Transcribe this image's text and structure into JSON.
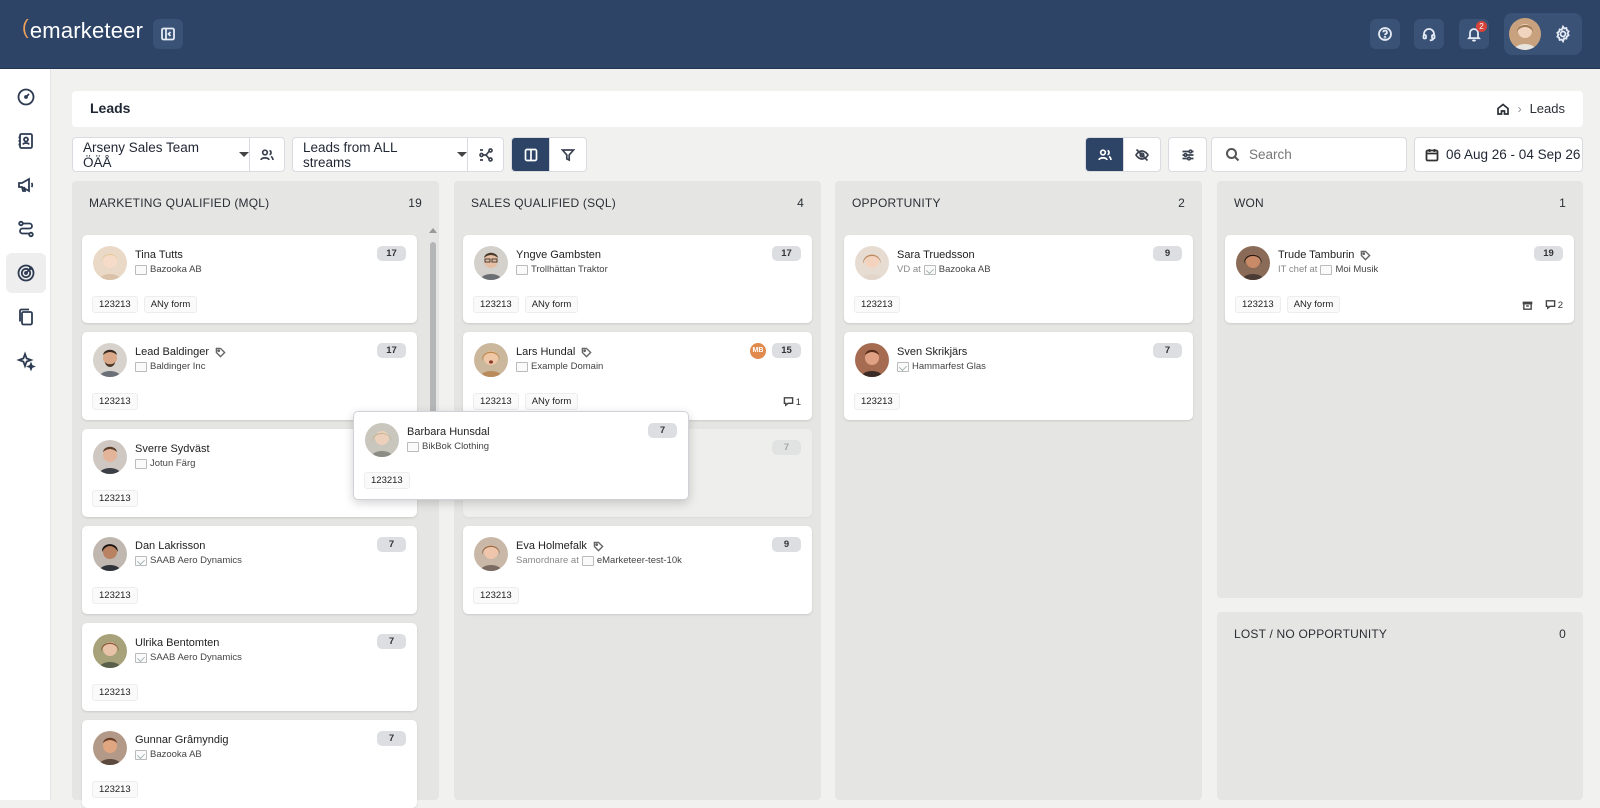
{
  "brand": {
    "logo_text": "emarketeer",
    "logo_mark": "("
  },
  "topbar": {
    "notification_count": "2"
  },
  "header": {
    "title": "Leads",
    "breadcrumb_current": "Leads"
  },
  "toolbar": {
    "team_select": "Arseny Sales Team ÖÄÅ",
    "stream_select": "Leads from ALL streams",
    "search_placeholder": "Search",
    "date_range": "06 Aug 26 - 04 Sep 26"
  },
  "columns": [
    {
      "title": "MARKETING QUALIFIED (MQL)",
      "count": "19",
      "cards": [
        {
          "name": "Tina Tutts",
          "org": "Bazooka AB",
          "score": "17",
          "pills": [
            "123213",
            "ANy form"
          ]
        },
        {
          "name": "Lead Baldinger",
          "org": "Baldinger Inc",
          "score": "17",
          "pills": [
            "123213"
          ]
        },
        {
          "name": "Sverre Sydväst",
          "org": "Jotun Färg",
          "score": "7",
          "pills": [
            "123213"
          ]
        },
        {
          "name": "Dan Lakrisson",
          "org": "SAAB Aero Dynamics",
          "score": "7",
          "pills": [
            "123213"
          ]
        },
        {
          "name": "Ulrika Bentomten",
          "org": "SAAB Aero Dynamics",
          "score": "7",
          "pills": [
            "123213"
          ]
        },
        {
          "name": "Gunnar Grâmyndig",
          "org": "Bazooka AB",
          "score": "7",
          "pills": [
            "123213"
          ]
        }
      ]
    },
    {
      "title": "SALES QUALIFIED (SQL)",
      "count": "4",
      "cards": [
        {
          "name": "Yngve Gambsten",
          "org": "Trollhättan Traktor",
          "score": "17",
          "pills": [
            "123213",
            "ANy form"
          ]
        },
        {
          "name": "Lars Hundal",
          "org": "Example Domain",
          "score": "15",
          "pills": [
            "123213",
            "ANy form"
          ],
          "owner_initials": "MB",
          "comments": "1"
        },
        {
          "name": "",
          "org": "",
          "score": "7",
          "pills": []
        },
        {
          "name": "Eva Holmefalk",
          "org_prefix": "Samordnare at",
          "org": "eMarketeer-test-10k",
          "score": "9",
          "pills": [
            "123213"
          ]
        }
      ]
    },
    {
      "title": "OPPORTUNITY",
      "count": "2",
      "cards": [
        {
          "name": "Sara Truedsson",
          "org_prefix": "VD at",
          "org": "Bazooka AB",
          "score": "9",
          "pills": [
            "123213"
          ]
        },
        {
          "name": "Sven Skrikjärs",
          "org": "Hammarfest Glas",
          "score": "7",
          "pills": [
            "123213"
          ]
        }
      ]
    },
    {
      "title": "WON",
      "count": "1",
      "cards": [
        {
          "name": "Trude Tamburin",
          "org_prefix": "IT chef at",
          "org": "Moi Musik",
          "score": "19",
          "pills": [
            "123213",
            "ANy form"
          ],
          "comments": "2"
        }
      ]
    },
    {
      "title": "LOST / NO OPPORTUNITY",
      "count": "0",
      "cards": []
    }
  ],
  "dragging_card": {
    "name": "Barbara Hunsdal",
    "org": "BikBok Clothing",
    "score": "7",
    "pills": [
      "123213"
    ]
  },
  "colors": {
    "topbar": "#2d4467",
    "accent_orange": "#f0a25a",
    "badge_red": "#d8443a"
  }
}
